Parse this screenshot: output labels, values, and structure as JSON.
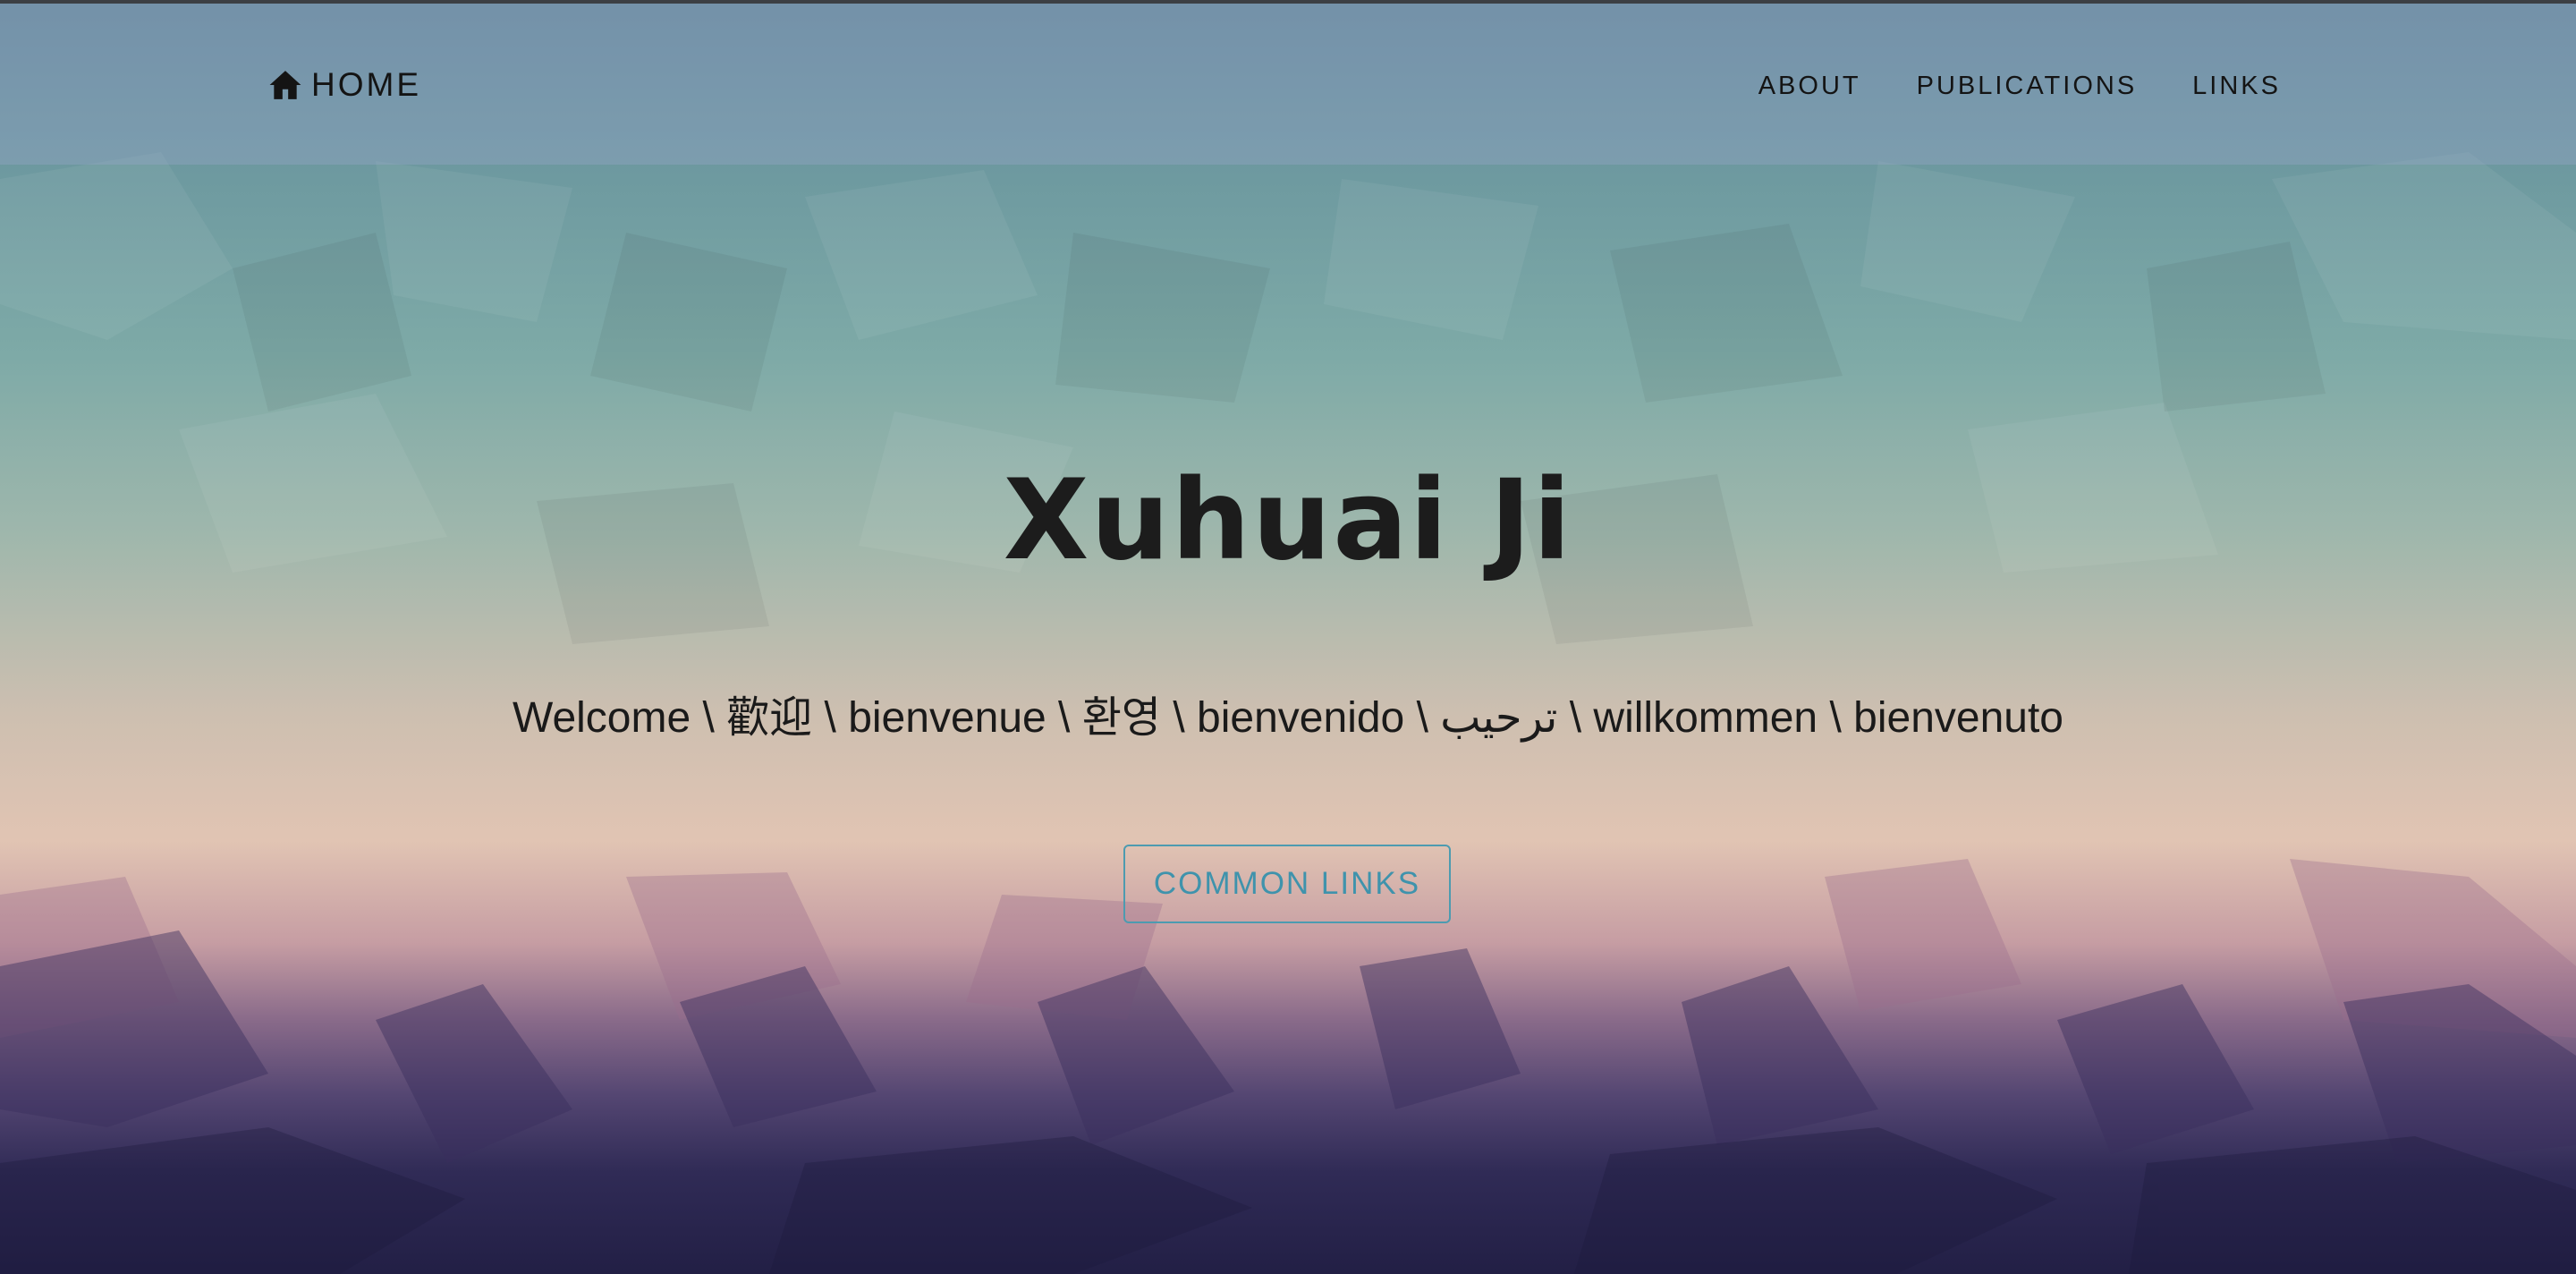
{
  "navbar": {
    "home_label": "HOME",
    "home_icon": "home-icon",
    "items": [
      {
        "label": "ABOUT"
      },
      {
        "label": "PUBLICATIONS"
      },
      {
        "label": "LINKS"
      }
    ]
  },
  "hero": {
    "title": "Xuhuai Ji",
    "welcome": "Welcome \\ 歡迎 \\ bienvenue \\ 환영 \\ bienvenido \\ ترحيب \\ willkommen \\ bienvenuto",
    "button_label": "COMMON LINKS"
  },
  "colors": {
    "nav_text": "#141414",
    "title_text": "#1c1c1c",
    "button_accent": "#3f93ac"
  }
}
